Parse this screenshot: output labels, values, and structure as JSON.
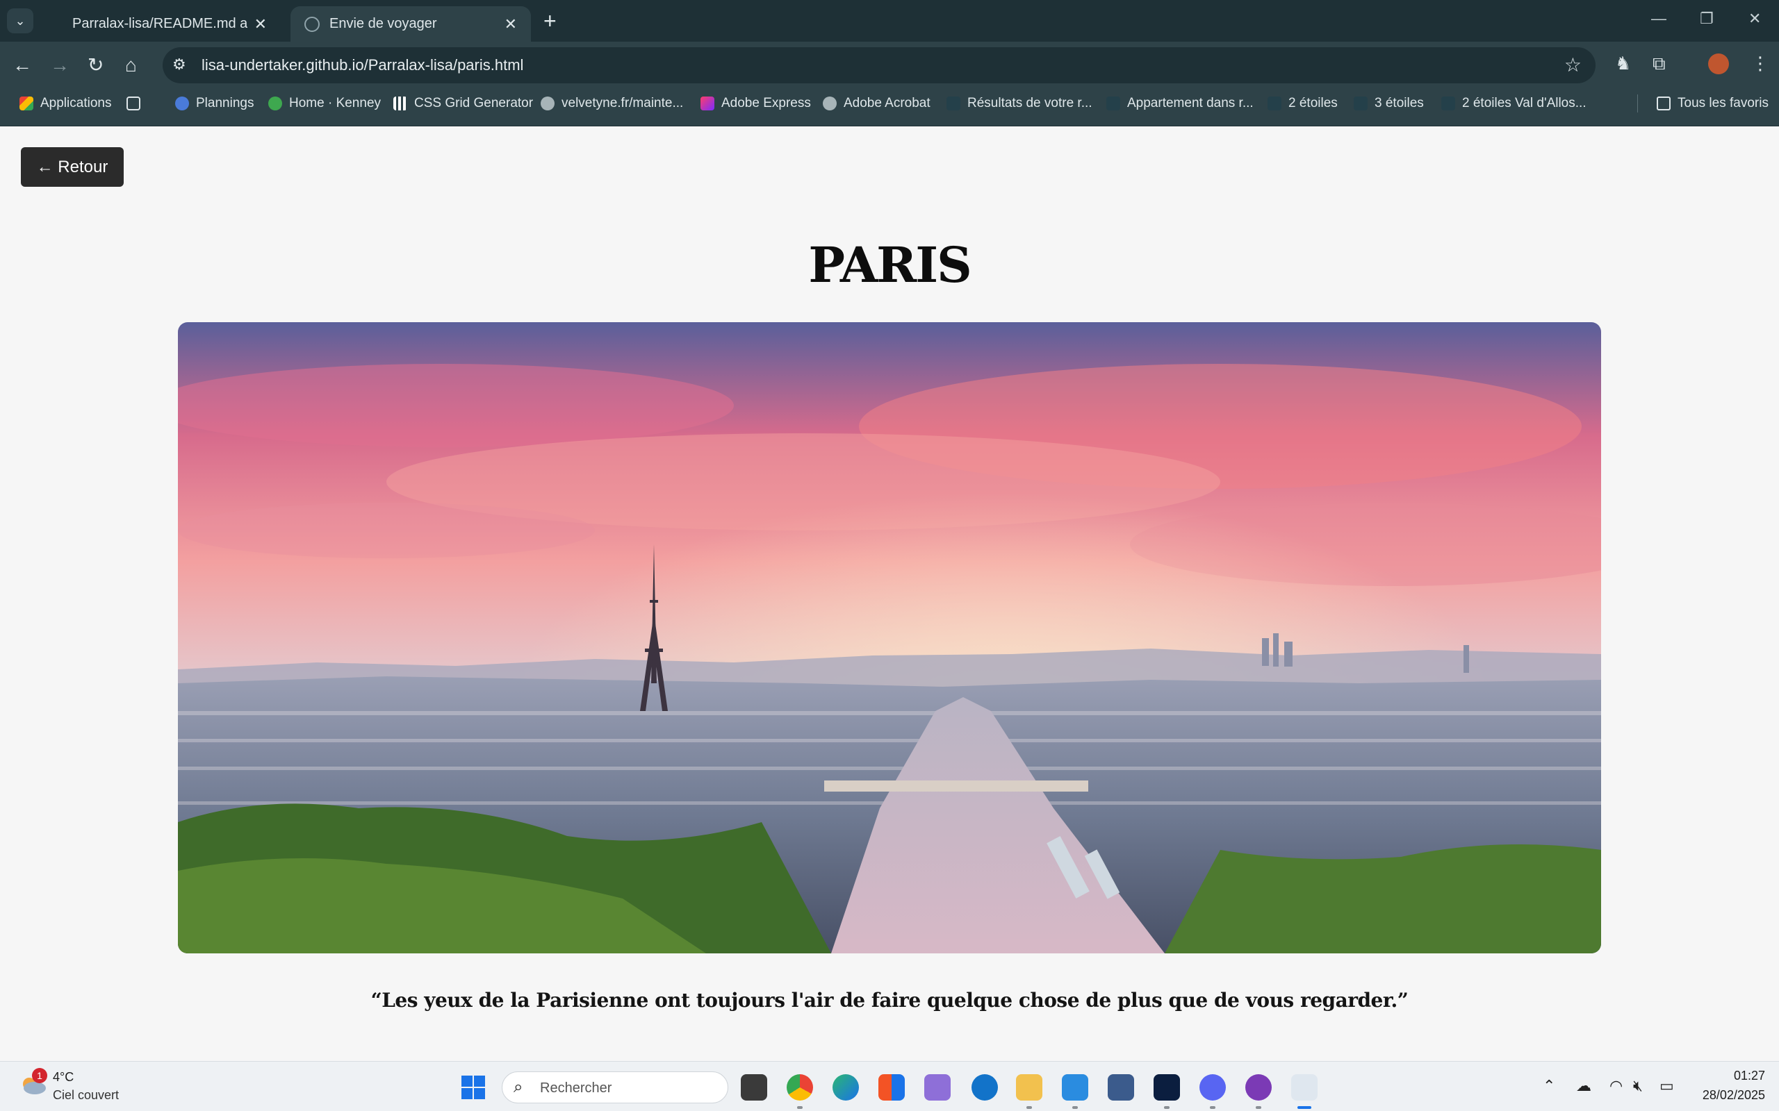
{
  "browser": {
    "tabs": [
      {
        "title": "Parralax-lisa/README.md at ma",
        "active": false
      },
      {
        "title": "Envie de voyager",
        "active": true
      }
    ],
    "url": "lisa-undertaker.github.io/Parralax-lisa/paris.html",
    "bookmarks": [
      {
        "label": "Applications",
        "icon": "apps-grid-icon"
      },
      {
        "label": "",
        "icon": "tab-groups-icon"
      },
      {
        "label": "Plannings",
        "icon": "g-icon"
      },
      {
        "label": "Home · Kenney",
        "icon": "kenney-icon"
      },
      {
        "label": "CSS Grid Generator",
        "icon": "grid-icon"
      },
      {
        "label": "velvetyne.fr/mainte...",
        "icon": "globe-icon"
      },
      {
        "label": "Adobe Express",
        "icon": "adobe-express-icon"
      },
      {
        "label": "Adobe Acrobat",
        "icon": "globe-icon"
      },
      {
        "label": "Résultats de votre r...",
        "icon": "bookmark-icon"
      },
      {
        "label": "Appartement dans r...",
        "icon": "bookmark-icon"
      },
      {
        "label": "2 étoiles",
        "icon": "bookmark-icon"
      },
      {
        "label": "3 étoiles",
        "icon": "bookmark-icon"
      },
      {
        "label": "2 étoiles Val d'Allos...",
        "icon": "bookmark-icon"
      }
    ],
    "all_bookmarks_label": "Tous les favoris"
  },
  "page": {
    "back_label": "← Retour",
    "title": "PARIS",
    "quote": "“Les yeux de la Parisienne ont toujours l'air de faire quelque chose de plus que de vous regarder.”"
  },
  "taskbar": {
    "weather": {
      "badge": "1",
      "temp": "4°C",
      "desc": "Ciel couvert"
    },
    "search_placeholder": "Rechercher",
    "apps": [
      "task-view",
      "chrome",
      "edge",
      "store",
      "app-purple",
      "app-circle",
      "file-explorer",
      "vscode",
      "remote-desktop",
      "photoshop",
      "discord",
      "github-desktop",
      "paint"
    ],
    "time": "01:27",
    "date": "28/02/2025"
  },
  "colors": {
    "chrome_dark": "#1e3036",
    "chrome": "#2e4248",
    "page_bg": "#f6f6f6",
    "button_bg": "#2b2b2b"
  }
}
